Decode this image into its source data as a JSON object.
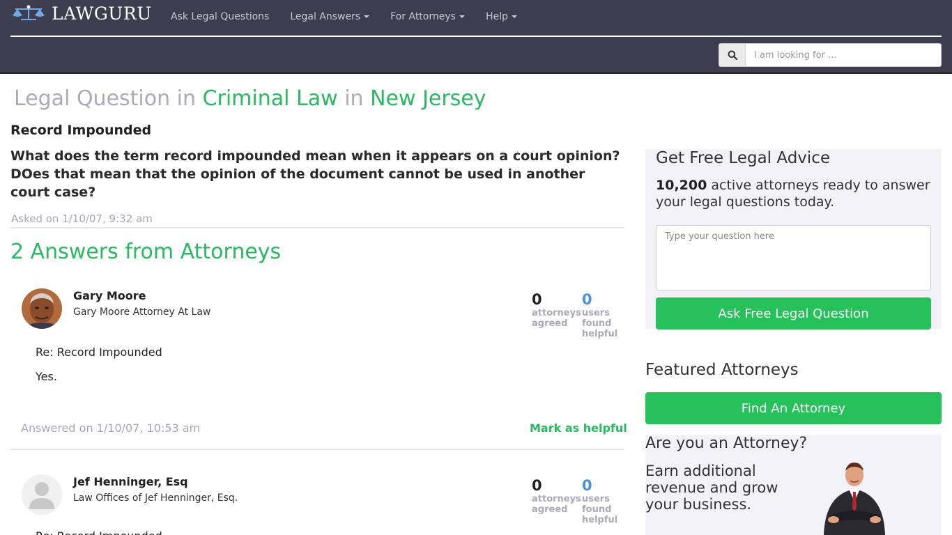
{
  "header": {
    "logo_text": "LAWGURU",
    "nav": [
      {
        "label": "Ask Legal Questions",
        "dropdown": false
      },
      {
        "label": "Legal Answers",
        "dropdown": true
      },
      {
        "label": "For Attorneys",
        "dropdown": true
      },
      {
        "label": "Help",
        "dropdown": true
      }
    ],
    "search": {
      "placeholder": "I am looking for ...",
      "icon": "search-icon"
    }
  },
  "page": {
    "title_prefix": "Legal Question in",
    "category": "Criminal Law",
    "title_mid": "in",
    "state": "New Jersey"
  },
  "question": {
    "title": "Record Impounded",
    "body": "What does the term record impounded mean when it appears on a court opinion? DOes that mean that the opinion of the document cannot be used in another court case?",
    "asked": "Asked on 1/10/07, 9:32 am"
  },
  "answers_title": "2 Answers from Attorneys",
  "answers": [
    {
      "name": "Gary Moore",
      "firm": "Gary Moore Attorney At Law",
      "agreed": "0",
      "agreed_label": "attorneys agreed",
      "helpful": "0",
      "helpful_label": "users found helpful",
      "re": "Re: Record Impounded",
      "text": "Yes.",
      "answered": "Answered on 1/10/07, 10:53 am",
      "mark_label": "Mark as helpful"
    },
    {
      "name": "Jef Henninger, Esq",
      "firm": "Law Offices of Jef Henninger, Esq.",
      "agreed": "0",
      "agreed_label": "attorneys agreed",
      "helpful": "0",
      "helpful_label": "users found helpful",
      "re": "Re: Record Impounded"
    }
  ],
  "sidebar": {
    "advice_title": "Get Free Legal Advice",
    "attorney_count": "10,200",
    "advice_text": "active attorneys ready to answer your legal questions today.",
    "question_placeholder": "Type your question here",
    "ask_button": "Ask Free Legal Question",
    "featured_title": "Featured Attorneys",
    "find_button": "Find An Attorney",
    "attorney_title": "Are you an Attorney?",
    "attorney_text": "Earn additional revenue and grow your business."
  },
  "colors": {
    "header_bg": "#3d3d4f",
    "accent_green": "#2ab860",
    "button_green": "#27c15c",
    "stat_blue": "#4a8fe0",
    "muted": "#a8a8b8"
  }
}
